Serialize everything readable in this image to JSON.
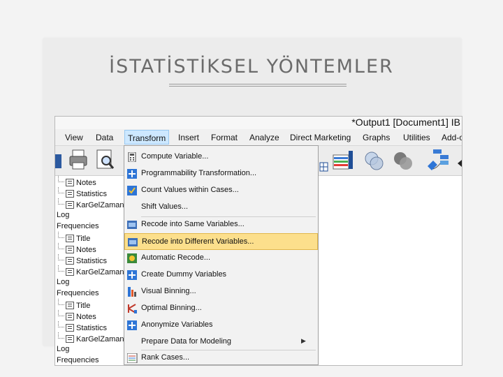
{
  "slide": {
    "title": "İSTATİSTİKSEL YÖNTEMLER"
  },
  "window": {
    "title": "*Output1 [Document1]  IB"
  },
  "menubar": {
    "items": [
      {
        "label": "View",
        "name": "menu-view"
      },
      {
        "label": "Data",
        "name": "menu-data"
      },
      {
        "label": "Transform",
        "name": "menu-transform"
      },
      {
        "label": "Insert",
        "name": "menu-insert"
      },
      {
        "label": "Format",
        "name": "menu-format"
      },
      {
        "label": "Analyze",
        "name": "menu-analyze"
      },
      {
        "label": "Direct Marketing",
        "name": "menu-direct-marketing"
      },
      {
        "label": "Graphs",
        "name": "menu-graphs"
      },
      {
        "label": "Utilities",
        "name": "menu-utilities"
      },
      {
        "label": "Add-o",
        "name": "menu-addons"
      }
    ]
  },
  "toolbar": {
    "icons": [
      "print-icon",
      "print-preview-icon",
      "pivot-table-icon",
      "venn-diagram-icon",
      "venn-diagram-dark-icon",
      "chart-builder-icon"
    ]
  },
  "outline": {
    "items": [
      {
        "label": "Notes",
        "type": "child"
      },
      {
        "label": "Statistics",
        "type": "child"
      },
      {
        "label": "KarGelZaman",
        "type": "child"
      },
      {
        "label": "Log",
        "type": "root"
      },
      {
        "label": "Frequencies",
        "type": "root"
      },
      {
        "label": "Title",
        "type": "child"
      },
      {
        "label": "Notes",
        "type": "child"
      },
      {
        "label": "Statistics",
        "type": "child"
      },
      {
        "label": "KarGelZaman",
        "type": "child"
      },
      {
        "label": "Log",
        "type": "root"
      },
      {
        "label": "Frequencies",
        "type": "root"
      },
      {
        "label": "Title",
        "type": "child"
      },
      {
        "label": "Notes",
        "type": "child"
      },
      {
        "label": "Statistics",
        "type": "child"
      },
      {
        "label": "KarGelZaman",
        "type": "child"
      },
      {
        "label": "Log",
        "type": "root"
      },
      {
        "label": "Frequencies",
        "type": "root"
      }
    ]
  },
  "transform_menu": {
    "items": [
      {
        "label": "Compute Variable...",
        "icon": "calculator-icon"
      },
      {
        "label": "Programmability Transformation...",
        "icon": "plus-icon"
      },
      {
        "label": "Count Values within Cases...",
        "icon": "count-values-icon"
      },
      {
        "label": "Shift Values...",
        "icon": ""
      },
      {
        "label": "Recode into Same Variables...",
        "icon": "recode-same-icon",
        "separator_before": true
      },
      {
        "label": "Recode into Different Variables...",
        "icon": "recode-different-icon",
        "highlighted": true
      },
      {
        "label": "Automatic Recode...",
        "icon": "automatic-recode-icon"
      },
      {
        "label": "Create Dummy Variables",
        "icon": "plus-icon"
      },
      {
        "label": "Visual Binning...",
        "icon": "visual-binning-icon"
      },
      {
        "label": "Optimal Binning...",
        "icon": "optimal-binning-icon"
      },
      {
        "label": "Anonymize Variables",
        "icon": "plus-icon"
      },
      {
        "label": "Prepare Data for Modeling",
        "icon": "",
        "submenu": true
      },
      {
        "label": "Rank Cases...",
        "icon": "rank-cases-icon",
        "separator_before": true
      }
    ]
  },
  "colors": {
    "highlight": "#fcdf8c",
    "menu_active": "#cde8ff",
    "icon_blue": "#2e75d6"
  }
}
